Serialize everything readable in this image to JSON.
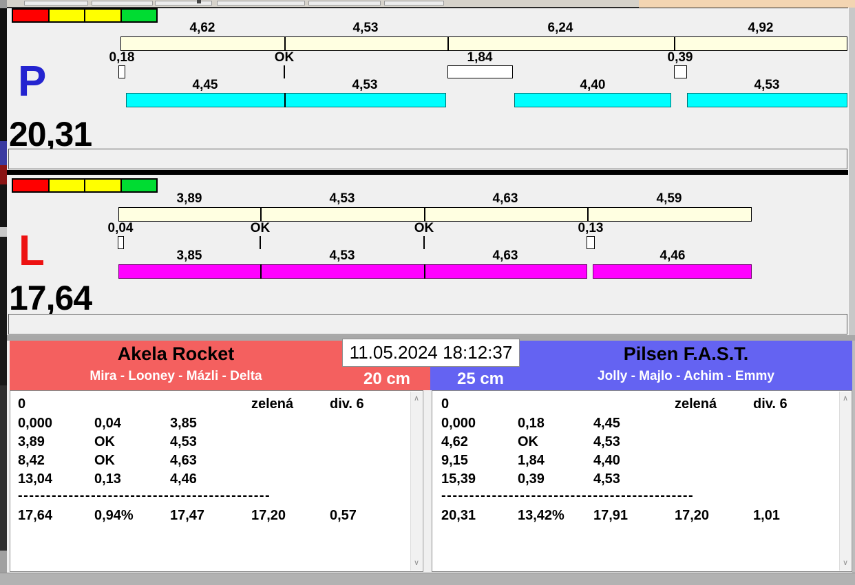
{
  "chrome": {
    "top_strip_accent": "#f3d5b2",
    "window_bg": "#f0f0f0"
  },
  "lanes": [
    {
      "letter": "P",
      "letter_color": "#2424d0",
      "total": "20,31",
      "bar_color": "#00ffff",
      "lights": [
        "#ff0000",
        "#ffff00",
        "#ffff00",
        "#00dc32"
      ],
      "splits_top": [
        "4,62",
        "4,53",
        "6,24",
        "4,92"
      ],
      "marks": [
        "0,18",
        "OK",
        "1,84",
        "0,39"
      ],
      "splits_bottom": [
        "4,45",
        "4,53",
        "4,40",
        "4,53"
      ]
    },
    {
      "letter": "L",
      "letter_color": "#ed1212",
      "total": "17,64",
      "bar_color": "#ff00ff",
      "lights": [
        "#ff0000",
        "#ffff00",
        "#ffff00",
        "#00dc32"
      ],
      "splits_top": [
        "3,89",
        "4,53",
        "4,63",
        "4,59"
      ],
      "marks": [
        "0,04",
        "OK",
        "OK",
        "0,13"
      ],
      "splits_bottom": [
        "3,85",
        "4,53",
        "4,63",
        "4,46"
      ]
    }
  ],
  "datetime": "11.05.2024 18:12:37",
  "panels": [
    {
      "team": "Akela Rocket",
      "dogs": "Mira - Looney - Mázli - Delta",
      "height": "20 cm",
      "color": "#f4605f",
      "info": {
        "c1": "0",
        "c4": "zelená",
        "c5": "div. 6"
      },
      "rows": [
        [
          "0,000",
          "0,04",
          "3,85"
        ],
        [
          "3,89",
          "OK",
          "4,53"
        ],
        [
          "8,42",
          "OK",
          "4,63"
        ],
        [
          "13,04",
          "0,13",
          "4,46"
        ]
      ],
      "separator": "---------------------------------------------",
      "totals": [
        "17,64",
        "0,94%",
        "17,47",
        "17,20",
        "0,57"
      ]
    },
    {
      "team": "Pilsen F.A.S.T.",
      "dogs": "Jolly - Majlo - Achim - Emmy",
      "height": "25 cm",
      "color": "#6463f2",
      "info": {
        "c1": "0",
        "c4": "zelená",
        "c5": "div. 6"
      },
      "rows": [
        [
          "0,000",
          "0,18",
          "4,45"
        ],
        [
          "4,62",
          "OK",
          "4,53"
        ],
        [
          "9,15",
          "1,84",
          "4,40"
        ],
        [
          "15,39",
          "0,39",
          "4,53"
        ]
      ],
      "separator": "---------------------------------------------",
      "totals": [
        "20,31",
        "13,42%",
        "17,91",
        "17,20",
        "1,01"
      ]
    }
  ]
}
